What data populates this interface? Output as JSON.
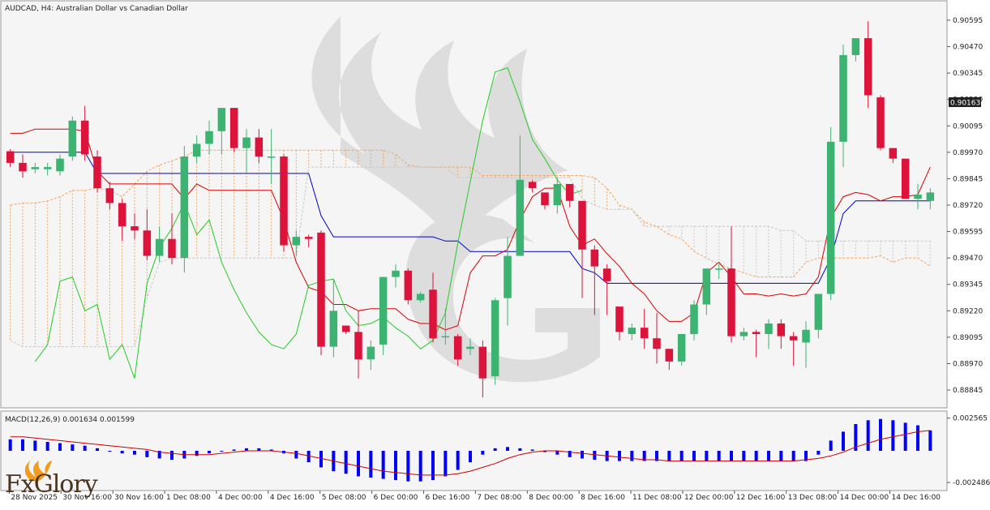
{
  "chart_title": "AUDCAD, H4:  Australian Dollar vs Canadian Dollar",
  "current_price_label": "0.90163",
  "macd_label": "MACD(12,26,9) 0.001634 0.001599",
  "logo_text": "FxGlory",
  "colors": {
    "background": "#f5f5f5",
    "bull": "#3cb371",
    "bear": "#dc143c",
    "kijun": "#0000cc",
    "tenkan": "#dd0000",
    "chikou": "#22cc22",
    "cloud": "#f4a460",
    "cloud_grey": "#c8c8c8",
    "macd_hist": "#0000ff",
    "macd_signal": "#cc0000"
  },
  "chart_data": [
    {
      "type": "candlestick",
      "title": "AUDCAD, H4:  Australian Dollar vs Canadian Dollar",
      "ylim": [
        0.8878,
        0.9066
      ],
      "y_ticks": [
        "0.90595",
        "0.90470",
        "0.90345",
        "0.90220",
        "0.90095",
        "0.89970",
        "0.89845",
        "0.89720",
        "0.89595",
        "0.89470",
        "0.89345",
        "0.89220",
        "0.89095",
        "0.88970",
        "0.88845"
      ],
      "x_ticks": [
        "28 Nov 2025",
        "30 Nov 16:00",
        "30 Nov 16:00",
        "1 Dec 08:00",
        "4 Dec 00:00",
        "4 Dec 16:00",
        "5 Dec 08:00",
        "6 Dec 00:00",
        "6 Dec 16:00",
        "7 Dec 08:00",
        "8 Dec 00:00",
        "8 Dec 16:00",
        "11 Dec 08:00",
        "12 Dec 00:00",
        "12 Dec 16:00",
        "13 Dec 08:00",
        "14 Dec 00:00",
        "14 Dec 16:00"
      ],
      "candles": [
        [
          0.89975,
          0.89985,
          0.899,
          0.8992
        ],
        [
          0.8992,
          0.8996,
          0.8985,
          0.8988
        ],
        [
          0.8989,
          0.8992,
          0.8987,
          0.899
        ],
        [
          0.8989,
          0.8992,
          0.8986,
          0.899
        ],
        [
          0.8988,
          0.8996,
          0.8986,
          0.8994
        ],
        [
          0.8995,
          0.9014,
          0.8993,
          0.9012
        ],
        [
          0.9012,
          0.9019,
          0.8993,
          0.8996
        ],
        [
          0.8995,
          0.8998,
          0.8978,
          0.898
        ],
        [
          0.898,
          0.8983,
          0.897,
          0.8973
        ],
        [
          0.8973,
          0.8975,
          0.8955,
          0.8962
        ],
        [
          0.8962,
          0.8968,
          0.8956,
          0.896
        ],
        [
          0.896,
          0.897,
          0.8946,
          0.8948
        ],
        [
          0.8948,
          0.8962,
          0.8945,
          0.8956
        ],
        [
          0.8956,
          0.8968,
          0.8944,
          0.8947
        ],
        [
          0.8947,
          0.9,
          0.894,
          0.8995
        ],
        [
          0.8995,
          0.9005,
          0.8992,
          0.9001
        ],
        [
          0.9001,
          0.9012,
          0.8996,
          0.9007
        ],
        [
          0.9007,
          0.9018,
          0.8996,
          0.9018
        ],
        [
          0.9018,
          0.9018,
          0.8997,
          0.8999
        ],
        [
          0.8999,
          0.9008,
          0.8987,
          0.9004
        ],
        [
          0.9004,
          0.9008,
          0.8992,
          0.8995
        ],
        [
          0.8995,
          0.9008,
          0.8982,
          0.8995
        ],
        [
          0.8995,
          0.8996,
          0.895,
          0.8953
        ],
        [
          0.8953,
          0.896,
          0.8948,
          0.8957
        ],
        [
          0.8957,
          0.8958,
          0.8952,
          0.8956
        ],
        [
          0.8959,
          0.896,
          0.8901,
          0.8905
        ],
        [
          0.8905,
          0.8937,
          0.89,
          0.8922
        ],
        [
          0.8915,
          0.8914,
          0.8911,
          0.8912
        ],
        [
          0.8912,
          0.8922,
          0.889,
          0.8899
        ],
        [
          0.8899,
          0.8908,
          0.8894,
          0.8905
        ],
        [
          0.8906,
          0.8938,
          0.8901,
          0.8938
        ],
        [
          0.8938,
          0.8944,
          0.8933,
          0.8941
        ],
        [
          0.8941,
          0.8942,
          0.8925,
          0.8927
        ],
        [
          0.8927,
          0.8931,
          0.8926,
          0.893
        ],
        [
          0.8932,
          0.894,
          0.8907,
          0.8909
        ],
        [
          0.891,
          0.8923,
          0.8906,
          0.891
        ],
        [
          0.891,
          0.8911,
          0.8896,
          0.8899
        ],
        [
          0.8904,
          0.8909,
          0.8901,
          0.8905
        ],
        [
          0.8905,
          0.8908,
          0.8881,
          0.889
        ],
        [
          0.8891,
          0.8928,
          0.8887,
          0.8927
        ],
        [
          0.8928,
          0.8957,
          0.8915,
          0.8948
        ],
        [
          0.8948,
          0.9005,
          0.8948,
          0.8984
        ],
        [
          0.8983,
          0.8984,
          0.8978,
          0.898
        ],
        [
          0.8978,
          0.8977,
          0.897,
          0.8972
        ],
        [
          0.8972,
          0.8985,
          0.8968,
          0.8982
        ],
        [
          0.8982,
          0.8981,
          0.8971,
          0.8974
        ],
        [
          0.8974,
          0.8972,
          0.8928,
          0.8951
        ],
        [
          0.8951,
          0.8953,
          0.892,
          0.8943
        ],
        [
          0.8942,
          0.8944,
          0.892,
          0.8936
        ],
        [
          0.8924,
          0.8922,
          0.8908,
          0.8912
        ],
        [
          0.8911,
          0.8916,
          0.8908,
          0.8914
        ],
        [
          0.8914,
          0.8923,
          0.8904,
          0.8909
        ],
        [
          0.8909,
          0.8921,
          0.8897,
          0.8904
        ],
        [
          0.8904,
          0.8903,
          0.8894,
          0.8898
        ],
        [
          0.8898,
          0.8911,
          0.8896,
          0.8911
        ],
        [
          0.8911,
          0.8927,
          0.8908,
          0.8925
        ],
        [
          0.8925,
          0.8942,
          0.892,
          0.8942
        ],
        [
          0.8942,
          0.8944,
          0.8937,
          0.8942
        ],
        [
          0.8942,
          0.8962,
          0.8907,
          0.891
        ],
        [
          0.891,
          0.8914,
          0.8908,
          0.8912
        ],
        [
          0.8912,
          0.8913,
          0.89,
          0.8911
        ],
        [
          0.8911,
          0.8918,
          0.8904,
          0.8916
        ],
        [
          0.8916,
          0.8918,
          0.8904,
          0.891
        ],
        [
          0.891,
          0.8912,
          0.8896,
          0.8908
        ],
        [
          0.8907,
          0.8917,
          0.8895,
          0.8913
        ],
        [
          0.8913,
          0.893,
          0.8909,
          0.893
        ],
        [
          0.893,
          0.9009,
          0.8927,
          0.9002
        ],
        [
          0.9002,
          0.9048,
          0.899,
          0.9043
        ],
        [
          0.9043,
          0.9047,
          0.904,
          0.9051
        ],
        [
          0.9051,
          0.9059,
          0.9018,
          0.9024
        ],
        [
          0.9023,
          0.9024,
          0.8998,
          0.8999
        ],
        [
          0.8999,
          0.8998,
          0.8992,
          0.8994
        ],
        [
          0.8994,
          0.8994,
          0.8976,
          0.8975
        ],
        [
          0.8975,
          0.8982,
          0.897,
          0.8977
        ],
        [
          0.8974,
          0.898,
          0.897,
          0.8978
        ]
      ],
      "kijun": [
        0.8997,
        0.8997,
        0.8997,
        0.8997,
        0.8997,
        0.8997,
        0.8997,
        0.8987,
        0.8987,
        0.8987,
        0.8987,
        0.8987,
        0.8987,
        0.8987,
        0.8987,
        0.8987,
        0.8987,
        0.8987,
        0.8987,
        0.8987,
        0.8987,
        0.8987,
        0.8987,
        0.8987,
        0.8987,
        0.8967,
        0.8957,
        0.8957,
        0.8957,
        0.8957,
        0.8957,
        0.8957,
        0.8957,
        0.8957,
        0.8957,
        0.8955,
        0.8955,
        0.895,
        0.895,
        0.895,
        0.895,
        0.895,
        0.895,
        0.895,
        0.895,
        0.895,
        0.8942,
        0.894,
        0.8935,
        0.8935,
        0.8935,
        0.8935,
        0.8935,
        0.8935,
        0.8935,
        0.8935,
        0.8935,
        0.8935,
        0.8935,
        0.8935,
        0.8935,
        0.8935,
        0.8935,
        0.8935,
        0.8935,
        0.8935,
        0.8947,
        0.8968,
        0.8974,
        0.8974,
        0.8974,
        0.8974,
        0.8974,
        0.8974,
        0.8974
      ],
      "tenkan": [
        0.9006,
        0.9006,
        0.9008,
        0.9008,
        0.9008,
        0.9008,
        0.9007,
        0.8988,
        0.8982,
        0.8982,
        0.8982,
        0.8982,
        0.8982,
        0.8982,
        0.8975,
        0.8982,
        0.8979,
        0.8979,
        0.8979,
        0.8979,
        0.8979,
        0.8979,
        0.8965,
        0.8945,
        0.8933,
        0.8931,
        0.8925,
        0.8925,
        0.8922,
        0.8923,
        0.8923,
        0.8923,
        0.8918,
        0.8916,
        0.8916,
        0.8913,
        0.8915,
        0.894,
        0.8948,
        0.8948,
        0.8951,
        0.8965,
        0.8976,
        0.898,
        0.898,
        0.8962,
        0.8953,
        0.8956,
        0.8949,
        0.8943,
        0.8935,
        0.893,
        0.8922,
        0.8917,
        0.8917,
        0.8921,
        0.894,
        0.8945,
        0.8938,
        0.893,
        0.893,
        0.8929,
        0.893,
        0.8929,
        0.893,
        0.8938,
        0.8966,
        0.8976,
        0.8978,
        0.8977,
        0.8974,
        0.8976,
        0.8976,
        0.8977,
        0.899
      ],
      "chikou": [
        0.8898,
        0.8906,
        0.8936,
        0.8938,
        0.8922,
        0.8925,
        0.8899,
        0.8906,
        0.889,
        0.8935,
        0.8952,
        0.8961,
        0.8973,
        0.8958,
        0.8965,
        0.8945,
        0.8932,
        0.8921,
        0.8912,
        0.8906,
        0.8904,
        0.8911,
        0.8934,
        0.8936,
        0.8937,
        0.8922,
        0.8915,
        0.8916,
        0.8919,
        0.8914,
        0.891,
        0.8904,
        0.8908,
        0.8921,
        0.8954,
        0.8983,
        0.9012,
        0.9035,
        0.9037,
        0.9021,
        0.9003,
        0.8994,
        0.8984,
        0.8977,
        0.8979
      ],
      "senkou_a": [
        0.8972,
        0.8973,
        0.8973,
        0.8974,
        0.8976,
        0.8979,
        0.8979,
        0.898,
        0.8979,
        0.8976,
        0.8982,
        0.8988,
        0.8991,
        0.8993,
        0.8995,
        0.8998,
        0.8998,
        0.8998,
        0.8998,
        0.8998,
        0.8998,
        0.8998,
        0.8998,
        0.8998,
        0.8998,
        0.8998,
        0.8998,
        0.8998,
        0.8998,
        0.8998,
        0.8998,
        0.8996,
        0.8991,
        0.899,
        0.899,
        0.899,
        0.899,
        0.899,
        0.8986,
        0.8986,
        0.8986,
        0.8986,
        0.8986,
        0.8986,
        0.8986,
        0.8986,
        0.8986,
        0.8985,
        0.898,
        0.8972,
        0.897,
        0.8964,
        0.8962,
        0.8958,
        0.8956,
        0.895,
        0.8947,
        0.8944,
        0.8942,
        0.894,
        0.8938,
        0.8938,
        0.8938,
        0.8938,
        0.8945,
        0.8947,
        0.8947,
        0.8947,
        0.8947,
        0.8947,
        0.8948,
        0.8945,
        0.8947,
        0.8947,
        0.8943
      ],
      "senkou_b": [
        0.8908,
        0.8905,
        0.8905,
        0.8905,
        0.8905,
        0.8905,
        0.8905,
        0.8905,
        0.8905,
        0.8905,
        0.8905,
        0.8928,
        0.8945,
        0.8947,
        0.8947,
        0.8947,
        0.8947,
        0.8947,
        0.8947,
        0.8947,
        0.8947,
        0.8947,
        0.8947,
        0.8947,
        0.899,
        0.899,
        0.899,
        0.899,
        0.899,
        0.899,
        0.899,
        0.899,
        0.899,
        0.899,
        0.899,
        0.899,
        0.8985,
        0.8985,
        0.8985,
        0.8985,
        0.8985,
        0.8985,
        0.8985,
        0.8985,
        0.8985,
        0.8985,
        0.8975,
        0.8972,
        0.897,
        0.897,
        0.897,
        0.8962,
        0.8962,
        0.8962,
        0.8962,
        0.8962,
        0.8962,
        0.8962,
        0.8962,
        0.8962,
        0.8962,
        0.8962,
        0.896,
        0.896,
        0.8955,
        0.8955,
        0.8955,
        0.8955,
        0.8955,
        0.8955,
        0.8955,
        0.8955,
        0.8955,
        0.8955,
        0.8955
      ]
    },
    {
      "type": "bar",
      "title": "MACD(12,26,9) 0.001634 0.001599",
      "ylim": [
        -0.0028,
        0.0028
      ],
      "y_ticks": [
        "0.002565",
        "-0.002486"
      ],
      "histogram": [
        0.0009,
        0.0009,
        0.0008,
        0.0007,
        0.0006,
        0.0005,
        0.0004,
        0.0002,
        0.0,
        -0.0002,
        -0.0003,
        -0.0005,
        -0.0006,
        -0.0007,
        -0.0006,
        -0.0004,
        -0.0002,
        0.0,
        0.0001,
        0.0002,
        0.0002,
        0.0001,
        -0.0002,
        -0.0006,
        -0.0009,
        -0.0013,
        -0.0016,
        -0.0018,
        -0.002,
        -0.0021,
        -0.0022,
        -0.0023,
        -0.0024,
        -0.0024,
        -0.0023,
        -0.002,
        -0.0015,
        -0.0009,
        -0.0003,
        0.0002,
        0.0003,
        0.0002,
        0.0001,
        -0.0001,
        -0.0003,
        -0.0005,
        -0.0006,
        -0.0007,
        -0.0008,
        -0.0008,
        -0.0008,
        -0.0008,
        -0.0008,
        -0.0008,
        -0.0008,
        -0.0008,
        -0.0008,
        -0.0008,
        -0.0008,
        -0.0008,
        -0.0008,
        -0.0008,
        -0.0008,
        -0.0008,
        -0.0008,
        -0.0003,
        0.0008,
        0.0015,
        0.0021,
        0.0024,
        0.0025,
        0.0024,
        0.0022,
        0.002,
        0.0016
      ],
      "signal": [
        0.0011,
        0.0011,
        0.001,
        0.0009,
        0.0008,
        0.0007,
        0.0006,
        0.0005,
        0.0004,
        0.0003,
        0.0002,
        0.0001,
        -0.0001,
        -0.0002,
        -0.0003,
        -0.0003,
        -0.0003,
        -0.0002,
        -0.0001,
        0.0,
        0.0,
        0.0,
        -0.0001,
        -0.0002,
        -0.0004,
        -0.0006,
        -0.0008,
        -0.001,
        -0.0012,
        -0.0014,
        -0.0016,
        -0.0017,
        -0.0018,
        -0.0019,
        -0.0019,
        -0.0019,
        -0.0018,
        -0.0016,
        -0.0013,
        -0.001,
        -0.0006,
        -0.0003,
        -0.0001,
        0.0,
        0.0,
        -0.0001,
        -0.0002,
        -0.0003,
        -0.0004,
        -0.0005,
        -0.0006,
        -0.0007,
        -0.0007,
        -0.0008,
        -0.0008,
        -0.0008,
        -0.0008,
        -0.0008,
        -0.0008,
        -0.0008,
        -0.0008,
        -0.0008,
        -0.0008,
        -0.0008,
        -0.0007,
        -0.0006,
        -0.0004,
        -0.0001,
        0.0003,
        0.0006,
        0.0009,
        0.0011,
        0.0013,
        0.0015,
        0.0016
      ]
    }
  ]
}
